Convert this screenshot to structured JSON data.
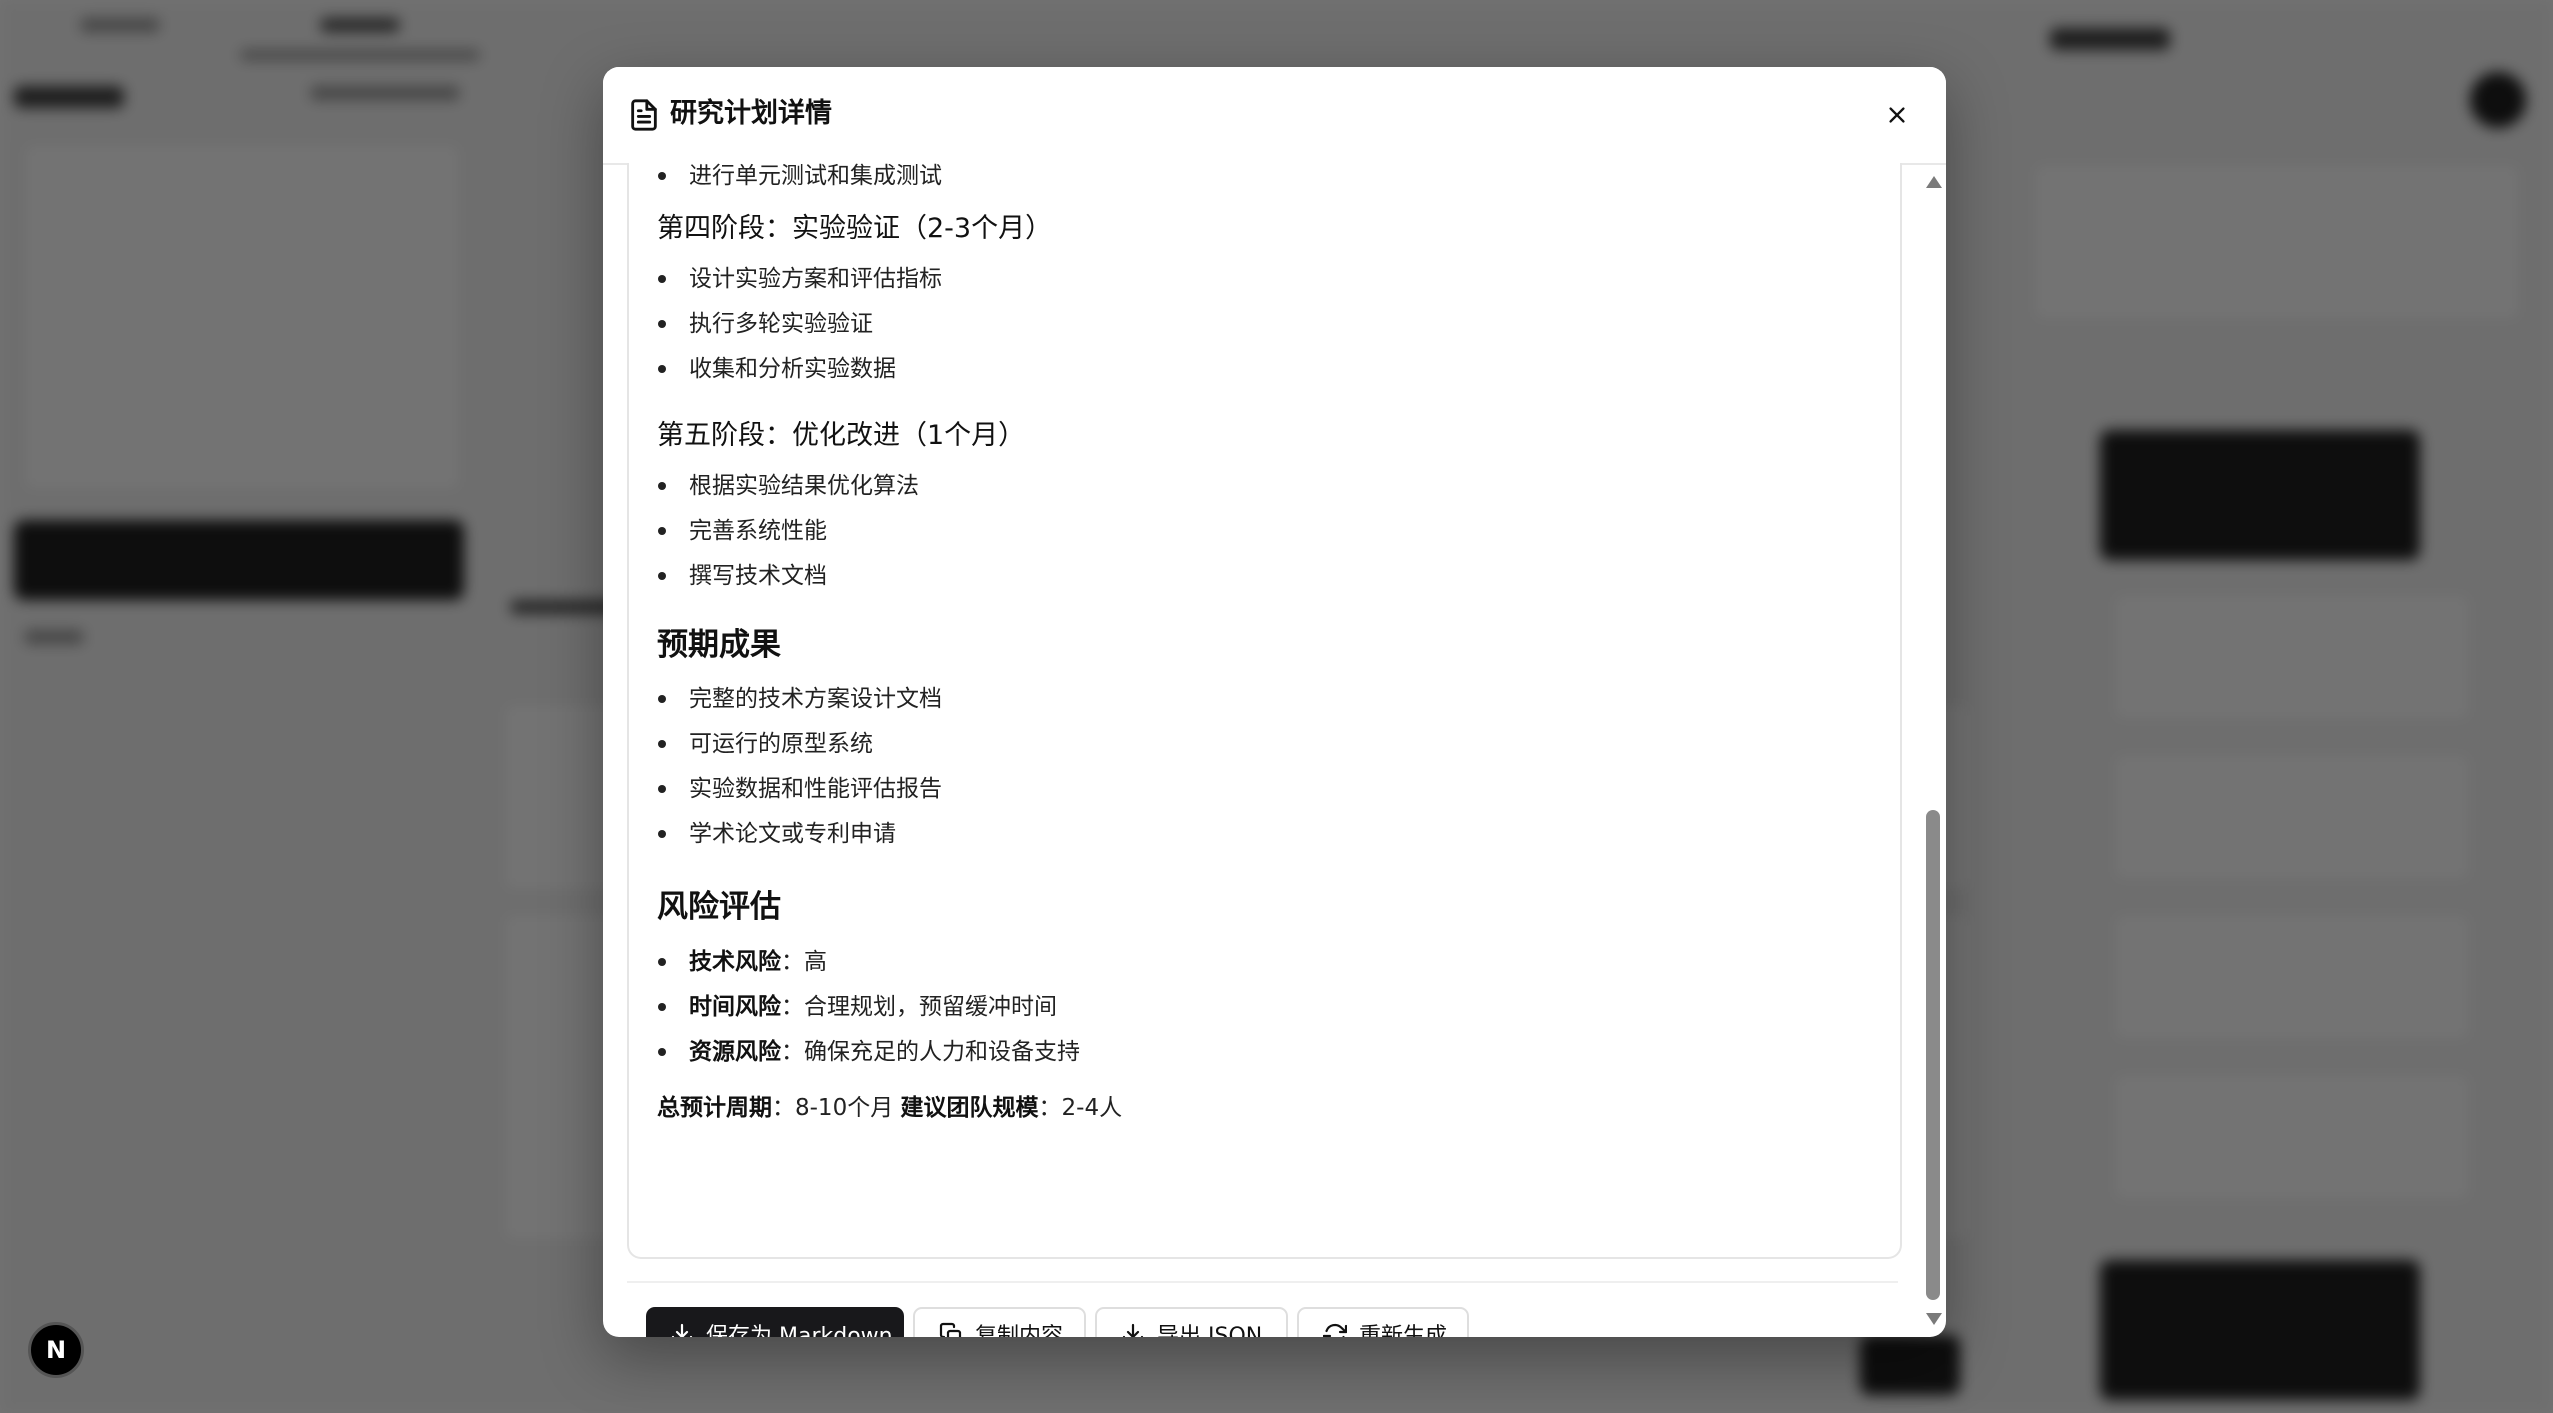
{
  "modal": {
    "title": "研究计划详情",
    "close_label": "×"
  },
  "content": {
    "partial_item": "进行单元测试和集成测试",
    "phase4": {
      "title": "第四阶段：实验验证（2-3个月）",
      "items": [
        "设计实验方案和评估指标",
        "执行多轮实验验证",
        "收集和分析实验数据"
      ]
    },
    "phase5": {
      "title": "第五阶段：优化改进（1个月）",
      "items": [
        "根据实验结果优化算法",
        "完善系统性能",
        "撰写技术文档"
      ]
    },
    "outcomes": {
      "title": "预期成果",
      "items": [
        "完整的技术方案设计文档",
        "可运行的原型系统",
        "实验数据和性能评估报告",
        "学术论文或专利申请"
      ]
    },
    "risks": {
      "title": "风险评估",
      "items": [
        {
          "label": "技术风险",
          "value": "：高"
        },
        {
          "label": "时间风险",
          "value": "：合理规划，预留缓冲时间"
        },
        {
          "label": "资源风险",
          "value": "：确保充足的人力和设备支持"
        }
      ]
    },
    "summary": {
      "period_label": "总预计周期",
      "period_value": "：8-10个月 ",
      "team_label": "建议团队规模",
      "team_value": "：2-4人"
    }
  },
  "footer": {
    "save_label": "保存为 Markdown",
    "copy_label": "复制内容",
    "export_label": "导出 JSON",
    "regenerate_label": "重新生成"
  },
  "badge": {
    "letter": "N"
  }
}
